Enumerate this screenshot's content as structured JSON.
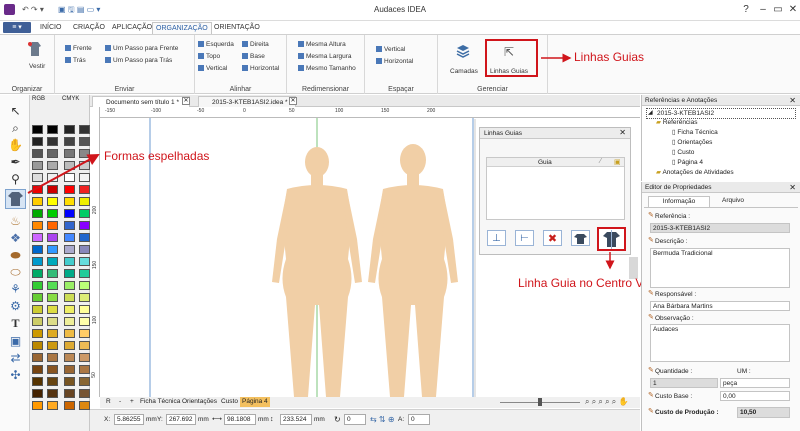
{
  "window": {
    "title": "Audaces IDEA"
  },
  "tabs": [
    {
      "label": "INÍCIO"
    },
    {
      "label": "CRIAÇÃO"
    },
    {
      "label": "APLICAÇÃO"
    },
    {
      "label": "ORGANIZAÇÃO"
    },
    {
      "label": "ORIENTAÇÃO"
    }
  ],
  "ribbon": {
    "organizar": {
      "label": "Organizar",
      "vestir": "Vestir"
    },
    "enviar": {
      "label": "Enviar",
      "frente": "Frente",
      "tras": "Trás",
      "passo_frente": "Um Passo para Frente",
      "passo_tras": "Um Passo para Trás"
    },
    "alinhar": {
      "label": "Alinhar",
      "esquerda": "Esquerda",
      "direita": "Direita",
      "topo": "Topo",
      "base": "Base",
      "vertical": "Vertical",
      "horizontal": "Horizontal"
    },
    "redimensionar": {
      "label": "Redimensionar",
      "altura": "Mesma Altura",
      "largura": "Mesma Largura",
      "tamanho": "Mesmo Tamanho"
    },
    "espacar": {
      "label": "Espaçar",
      "vertical": "Vertical",
      "horizontal": "Horizontal"
    },
    "gerenciar": {
      "label": "Gerenciar",
      "camadas": "Camadas",
      "linhas_guias": "Linhas Guias"
    }
  },
  "palettes": {
    "rgb": "RGB",
    "cmyk": "CMYK"
  },
  "doc_tabs": [
    {
      "label": "Documento sem título 1 *"
    },
    {
      "label": "2015-3-KTEB1ASI2.idea *"
    }
  ],
  "ruler": {
    "h": [
      "-150",
      "-100",
      "-50",
      "0",
      "50",
      "100",
      "150",
      "200"
    ],
    "v": [
      "200",
      "150",
      "100",
      "50"
    ]
  },
  "guides_panel": {
    "title": "Linhas Guias",
    "column": "Guia"
  },
  "page_tabs": [
    "R",
    "-",
    "+",
    "Ficha Técnica",
    "Orientações",
    "Custo",
    "Página 4"
  ],
  "status": {
    "x_label": "X:",
    "x": "5.86255",
    "y_label": "Y:",
    "y": "267.692",
    "unit": "mm",
    "w": "98.1808",
    "h": "233.524",
    "angle": "0",
    "a_label": "A:",
    "a": "0"
  },
  "refs": {
    "title": "Referências e Anotações",
    "root": "2015-3-KTEB1ASI2",
    "folder": "Referências",
    "items": [
      "Ficha Técnica",
      "Orientações",
      "Custo",
      "Página 4"
    ],
    "notes": "Anotações de Atividades"
  },
  "props": {
    "title": "Editor de Propriedades",
    "tab_info": "Informação",
    "tab_file": "Arquivo",
    "referencia_label": "Referência :",
    "referencia": "2015-3-KTEB1ASI2",
    "descricao_label": "Descrição :",
    "descricao": "Bermuda Tradicional",
    "responsavel_label": "Responsável :",
    "responsavel": "Ana Bárbara Martins",
    "observacao_label": "Observação :",
    "observacao": "Audaces",
    "quantidade_label": "Quantidade :",
    "um_label": "UM :",
    "quantidade": "1",
    "um": "peça",
    "custo_base_label": "Custo Base :",
    "custo_base": "0,00",
    "custo_producao_label": "Custo de Produção :",
    "custo_producao": "10,50"
  },
  "annotations": {
    "linhas_guias": "Linhas Guias",
    "formas": "Formas espelhadas",
    "centro": "Linha Guia no Centro Vertical"
  },
  "colors": {
    "accent": "#2a5fa5",
    "annotation": "#d0151b",
    "skin": "#f1cfa6"
  }
}
